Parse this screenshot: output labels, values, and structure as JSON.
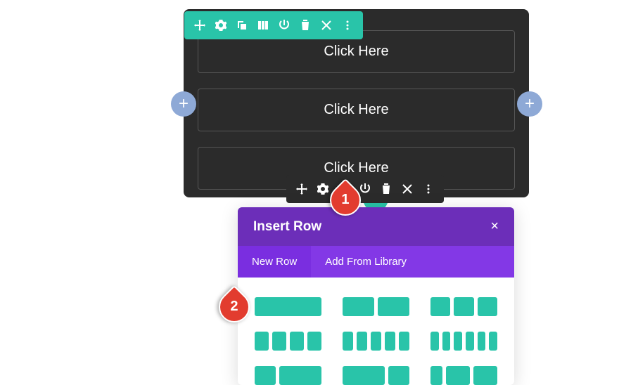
{
  "section": {
    "buttons": [
      "Click Here",
      "Click Here",
      "Click Here"
    ]
  },
  "panel": {
    "title": "Insert Row",
    "tabs": [
      "New Row",
      "Add From Library"
    ]
  },
  "markers": [
    "1",
    "2"
  ],
  "glyphs": {
    "plus": "+",
    "close": "×"
  }
}
